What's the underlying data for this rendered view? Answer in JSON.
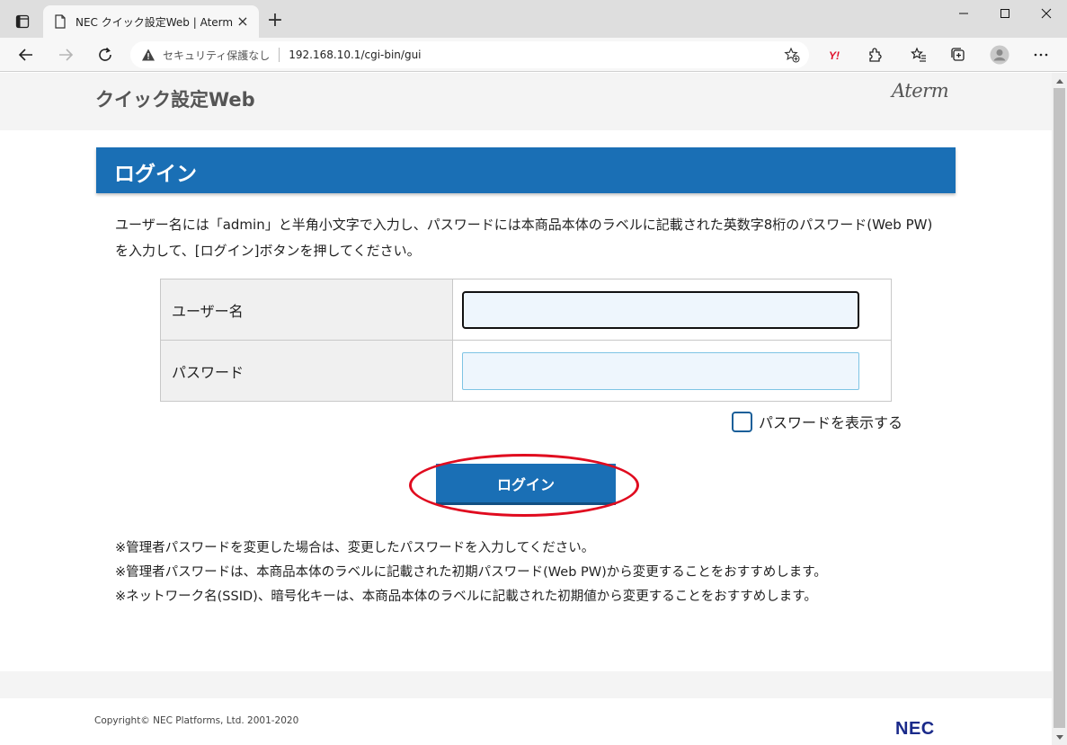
{
  "browser": {
    "tab_title": "NEC クイック設定Web | Aterm",
    "security_label": "セキュリティ保護なし",
    "url": "192.168.10.1/cgi-bin/gui"
  },
  "page": {
    "site_title": "クイック設定Web",
    "brand": "Aterm",
    "login_heading": "ログイン",
    "instructions": "ユーザー名には「admin」と半角小文字で入力し、パスワードには本商品本体のラベルに記載された英数字8桁のパスワード(Web PW)を入力して、[ログイン]ボタンを押してください。",
    "form": {
      "username_label": "ユーザー名",
      "username_value": "",
      "password_label": "パスワード",
      "password_value": ""
    },
    "show_password_label": "パスワードを表示する",
    "show_password_checked": false,
    "login_button": "ログイン",
    "notes": [
      "※管理者パスワードを変更した場合は、変更したパスワードを入力してください。",
      "※管理者パスワードは、本商品本体のラベルに記載された初期パスワード(Web PW)から変更することをおすすめします。",
      "※ネットワーク名(SSID)、暗号化キーは、本商品本体のラベルに記載された初期値から変更することをおすすめします。"
    ],
    "copyright": "Copyright© NEC Platforms, Ltd. 2001-2020",
    "footer_logo": "NEC"
  },
  "colors": {
    "primary": "#1a6fb5",
    "highlight_ellipse": "#e00b1f",
    "input_bg": "#eef6fd"
  }
}
